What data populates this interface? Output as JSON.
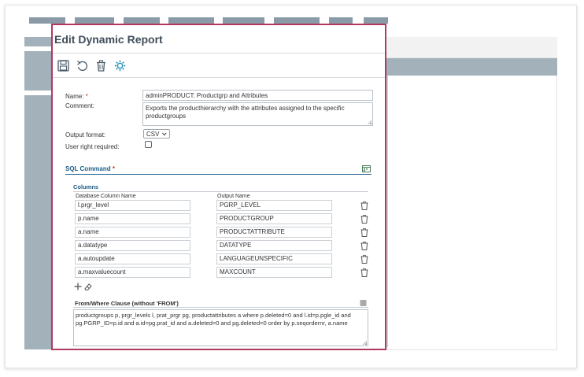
{
  "dialog": {
    "title": "Edit Dynamic Report",
    "toolbar": [
      "save-icon",
      "undo-icon",
      "delete-icon",
      "settings-icon"
    ]
  },
  "form": {
    "name_label": "Name:",
    "required_mark": "*",
    "name_value": "adminPRODUCT: Productgrp and Attributes",
    "comment_label": "Comment:",
    "comment_value": "Exports the producthierarchy with the attributes assigned to the specific productgroups",
    "output_format_label": "Output format:",
    "output_format_value": "CSV",
    "user_right_label": "User right required:",
    "user_right_checked": false
  },
  "sql_command": {
    "title": "SQL Command",
    "columns_title": "Columns",
    "header_db": "Database Column Name",
    "header_out": "Output Name",
    "rows": [
      {
        "db": "l.prgr_level",
        "out": "PGRP_LEVEL"
      },
      {
        "db": "p.name",
        "out": "PRODUCTGROUP"
      },
      {
        "db": "a.name",
        "out": "PRODUCTATTRIBUTE"
      },
      {
        "db": "a.datatype",
        "out": "DATATYPE"
      },
      {
        "db": "a.autoupdate",
        "out": "LANGUAGEUNSPECIFIC"
      },
      {
        "db": "a.maxvaluecount",
        "out": "MAXCOUNT"
      }
    ],
    "from_where_title": "From/Where Clause (without 'FROM')",
    "from_where_value": "productgroups p, prgr_levels l, prat_prgr pg, productattributes a  where p.deleted=0 and l.id=p.pgle_id and pg.PGRP_ID=p.id and a.id=pg.prat_id and a.deleted=0 and pg.deleted=0 order by p.seqordernr, a.name"
  },
  "colors": {
    "dialog_border": "#b2385e",
    "title_text": "#3f4d5a",
    "section_text": "#1d5b85",
    "toolbar_icon": "#4a5a66",
    "settings_icon": "#2a8fbd"
  }
}
